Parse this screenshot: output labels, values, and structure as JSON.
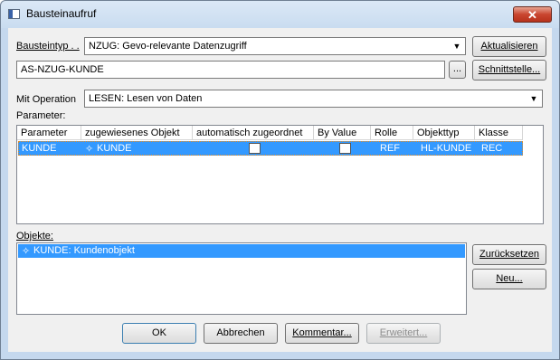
{
  "window": {
    "title": "Bausteinaufruf",
    "close_glyph": "✕"
  },
  "form": {
    "bausteintyp_label": "Bausteintyp . .",
    "bausteintyp_value": "NZUG: Gevo-relevante Datenzugriff",
    "name_value": "AS-NZUG-KUNDE",
    "browse_label": "...",
    "operation_label": "Mit Operation",
    "operation_value": "LESEN: Lesen von Daten",
    "parameter_label": "Parameter:",
    "objekte_label": "Objekte:"
  },
  "buttons": {
    "aktualisieren": "Aktualisieren",
    "schnittstelle": "Schnittstelle...",
    "zuruecksetzen": "Zurücksetzen",
    "neu": "Neu...",
    "ok": "OK",
    "abbrechen": "Abbrechen",
    "kommentar": "Kommentar...",
    "erweitert": "Erweitert..."
  },
  "parameter_table": {
    "columns": [
      "Parameter",
      "zugewiesenes Objekt",
      "automatisch zugeordnet",
      "By Value",
      "Rolle",
      "Objekttyp",
      "Klasse"
    ],
    "rows": [
      {
        "parameter": "KUNDE",
        "objekt": "KUNDE",
        "auto": false,
        "by_value": false,
        "rolle": "REF",
        "objekttyp": "HL-KUNDE",
        "klasse": "REC"
      }
    ]
  },
  "objekte_list": {
    "items": [
      "KUNDE: Kundenobjekt"
    ]
  },
  "icons": {
    "dropdown": "▼",
    "object": "✧"
  }
}
